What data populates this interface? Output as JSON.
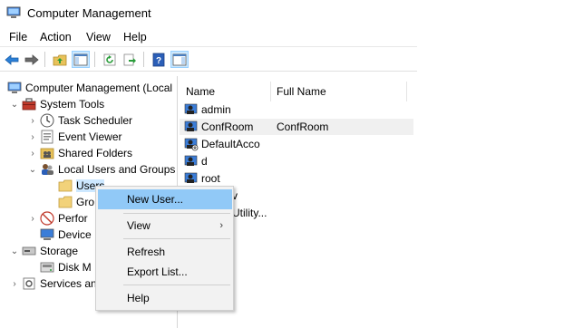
{
  "window": {
    "title": "Computer Management"
  },
  "menubar": [
    "File",
    "Action",
    "View",
    "Help"
  ],
  "toolbar": {
    "buttons": [
      "back-arrow-icon",
      "forward-arrow-icon",
      "up-folder-icon",
      "show-hide-tree-icon",
      "refresh-icon",
      "export-list-icon",
      "help-icon",
      "properties-icon"
    ],
    "accent": "#1e6fc7"
  },
  "tree": {
    "root": "Computer Management (Local",
    "items": [
      {
        "label": "System Tools",
        "icon": "toolbox-icon"
      },
      {
        "label": "Task Scheduler",
        "icon": "clock-icon"
      },
      {
        "label": "Event Viewer",
        "icon": "event-viewer-icon"
      },
      {
        "label": "Shared Folders",
        "icon": "shared-folder-icon"
      },
      {
        "label": "Local Users and Groups",
        "icon": "users-groups-icon"
      },
      {
        "label": "Users",
        "icon": "folder-icon"
      },
      {
        "label": "Gro",
        "icon": "folder-icon"
      },
      {
        "label": "Perfor",
        "icon": "performance-icon"
      },
      {
        "label": "Device",
        "icon": "device-manager-icon"
      },
      {
        "label": "Storage",
        "icon": "storage-icon"
      },
      {
        "label": "Disk M",
        "icon": "disk-icon"
      },
      {
        "label": "Services an",
        "icon": "services-icon"
      }
    ]
  },
  "list": {
    "columns": [
      "Name",
      "Full Name"
    ],
    "rows": [
      {
        "name": "admin",
        "full_name": ""
      },
      {
        "name": "ConfRoom",
        "full_name": "ConfRoom"
      },
      {
        "name": "DefaultAcco",
        "full_name": ""
      },
      {
        "name": "d",
        "full_name": ""
      },
      {
        "name": "root",
        "full_name": ""
      },
      {
        "name": "v",
        "full_name": ""
      },
      {
        "name": "Utility...",
        "full_name": ""
      }
    ]
  },
  "context_menu": {
    "items": [
      "New User...",
      "View",
      "Refresh",
      "Export List...",
      "Help"
    ],
    "highlight_color": "#91c9f7"
  }
}
